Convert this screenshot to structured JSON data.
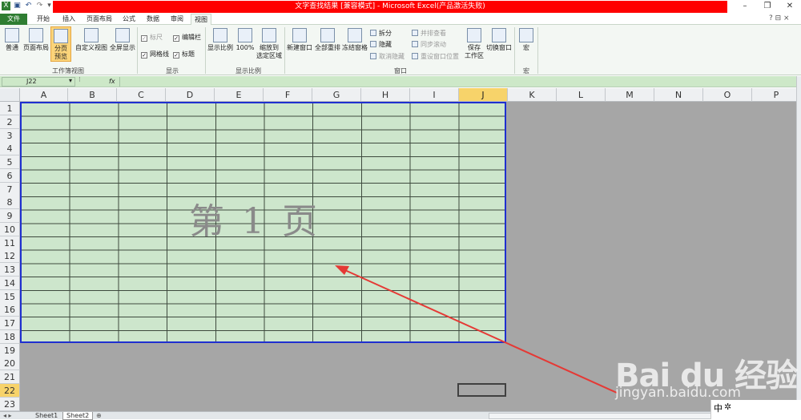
{
  "window": {
    "title": "文字查找结果 [兼容模式] - Microsoft Excel(产品激活失败)",
    "controls": [
      "minimize",
      "restore",
      "close"
    ]
  },
  "tabs": [
    "文件",
    "开始",
    "插入",
    "页面布局",
    "公式",
    "数据",
    "审阅",
    "视图"
  ],
  "ribbon": {
    "workbook_views": {
      "label": "工作簿视图",
      "normal": "普通",
      "page_layout": "页面布局",
      "page_break_preview": "分页\n预览",
      "custom_views": "自定义视图",
      "full_screen": "全屏显示"
    },
    "show": {
      "label": "显示",
      "ruler": "标尺",
      "formula_bar": "编辑栏",
      "gridlines": "网格线",
      "headings": "标题"
    },
    "zoom": {
      "label": "显示比例",
      "zoom": "显示比例",
      "zoom_100": "100%",
      "zoom_to_selection": "缩放到\n选定区域"
    },
    "window": {
      "label": "窗口",
      "new_window": "新建窗口",
      "arrange_all": "全部重排",
      "freeze_panes": "冻结窗格",
      "split": "拆分",
      "hide": "隐藏",
      "unhide": "取消隐藏",
      "view_side_by_side": "并排查看",
      "sync_scroll": "同步滚动",
      "reset_position": "重设窗口位置",
      "save_workspace": "保存\n工作区",
      "switch_windows": "切换窗口"
    },
    "macros": {
      "label": "宏",
      "macros": "宏"
    }
  },
  "formula_bar": {
    "name_box": "J22",
    "fx": "fx",
    "formula": ""
  },
  "sheet": {
    "columns": [
      "A",
      "B",
      "C",
      "D",
      "E",
      "F",
      "G",
      "H",
      "I",
      "J",
      "K",
      "L",
      "M",
      "N",
      "O",
      "P"
    ],
    "rows": [
      "1",
      "2",
      "3",
      "4",
      "5",
      "6",
      "7",
      "8",
      "9",
      "10",
      "11",
      "12",
      "13",
      "14",
      "15",
      "16",
      "17",
      "18",
      "19",
      "20",
      "21",
      "22",
      "23"
    ],
    "selected_column": "J",
    "selected_row": "22",
    "page_watermark": "第 1 页"
  },
  "sheet_tabs": [
    "Sheet1",
    "Sheet2"
  ],
  "active_sheet": "Sheet2",
  "overlay": {
    "baidu_logo": "Bai du 经验",
    "baidu_url": "jingyan.baidu.com",
    "ime_label": "中"
  },
  "colors": {
    "title_bar": "#ff0000",
    "file_tab": "#2f7d32",
    "print_area_fill": "#cde6cc",
    "print_area_border": "#1f2fd0",
    "selected_header": "#f7d36a",
    "annotation_arrow": "#e53935"
  }
}
